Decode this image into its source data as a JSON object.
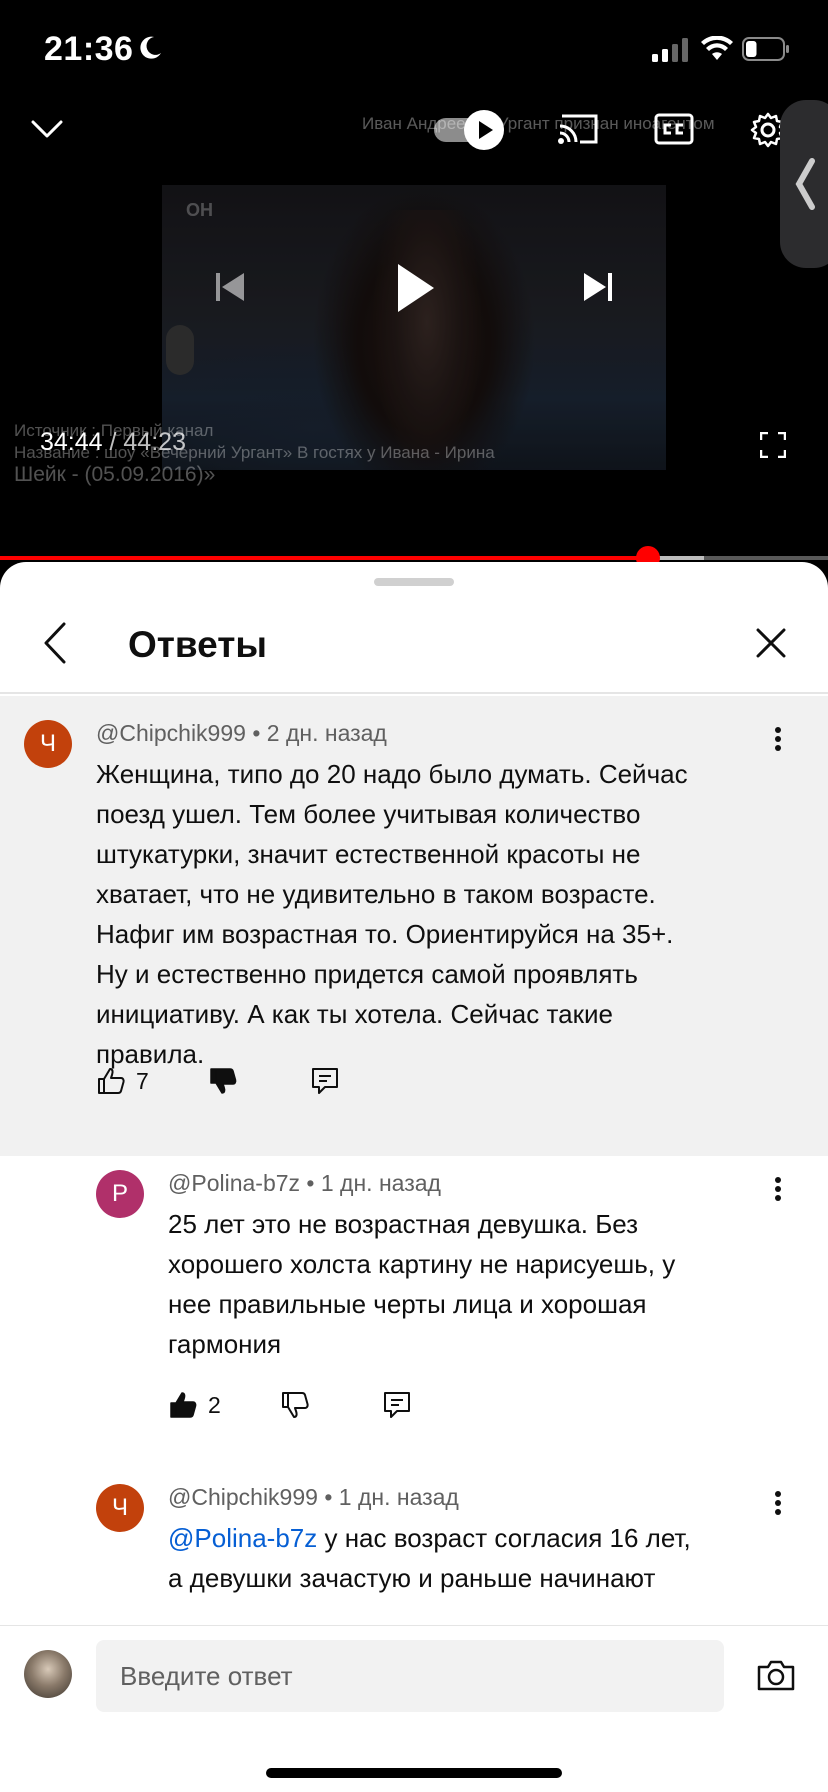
{
  "status_bar": {
    "time": "21:36",
    "battery_level": 0.3
  },
  "player": {
    "video_title_overlay": "Иван Андреевич Ургант признан иноагентом",
    "source_line1": "Источник : Первый канал",
    "source_line2": "Название : шоу «Вечерний Ургант» В гостях у Ивана - Ирина",
    "source_line3": "Шейк - (05.09.2016)»",
    "time_current": "34:44",
    "time_separator": " / ",
    "time_total": "44:23",
    "progress_fraction": 0.7825,
    "buffered_fraction": 0.85,
    "accent_color": "#ff0000"
  },
  "sheet": {
    "title": "Ответы"
  },
  "comments": [
    {
      "avatar_letter": "Ч",
      "avatar_color": "#c2410c",
      "author": "@Chipchik999",
      "dot": "•",
      "age": "2 дн. назад",
      "lines": [
        "Женщина, типо до 20 надо было думать. Сейчас",
        "поезд ушел. Тем более учитывая количество",
        "штукатурки, значит естественной красоты не",
        "хватает, что не удивительно в таком возрасте.",
        "Нафиг им возрастная то. Ориентируйся на 35+.",
        "Ну и естественно придется самой проявлять",
        "инициативу. А как ты хотела. Сейчас такие",
        "правила."
      ],
      "likes": "7",
      "liked": false,
      "disliked": true
    },
    {
      "avatar_letter": "P",
      "avatar_color": "#b0306a",
      "author": "@Polina-b7z",
      "dot": "•",
      "age": "1 дн. назад",
      "lines": [
        "25 лет это не возрастная девушка. Без",
        "хорошего холста картину не нарисуешь, у",
        "нее правильные черты лица и хорошая",
        "гармония"
      ],
      "likes": "2",
      "liked": true,
      "disliked": false
    },
    {
      "avatar_letter": "Ч",
      "avatar_color": "#c2410c",
      "author": "@Chipchik999",
      "dot": "•",
      "age": "1 дн. назад",
      "mention": "@Polina-b7z",
      "line1_rest": " у нас возраст согласия 16 лет,",
      "line2": "а девушки зачастую и раньше начинают"
    }
  ],
  "composer": {
    "placeholder": "Введите ответ"
  },
  "icons": [
    "chevron-down-icon",
    "play-icon",
    "cast-icon",
    "cc-icon",
    "gear-icon",
    "chevron-left-icon",
    "previous-icon",
    "next-icon",
    "fullscreen-icon",
    "back-icon",
    "close-icon",
    "more-vert-icon",
    "thumb-up-icon",
    "thumb-down-icon",
    "reply-icon",
    "camera-icon",
    "moon-icon",
    "signal-icon",
    "wifi-icon",
    "battery-icon"
  ]
}
